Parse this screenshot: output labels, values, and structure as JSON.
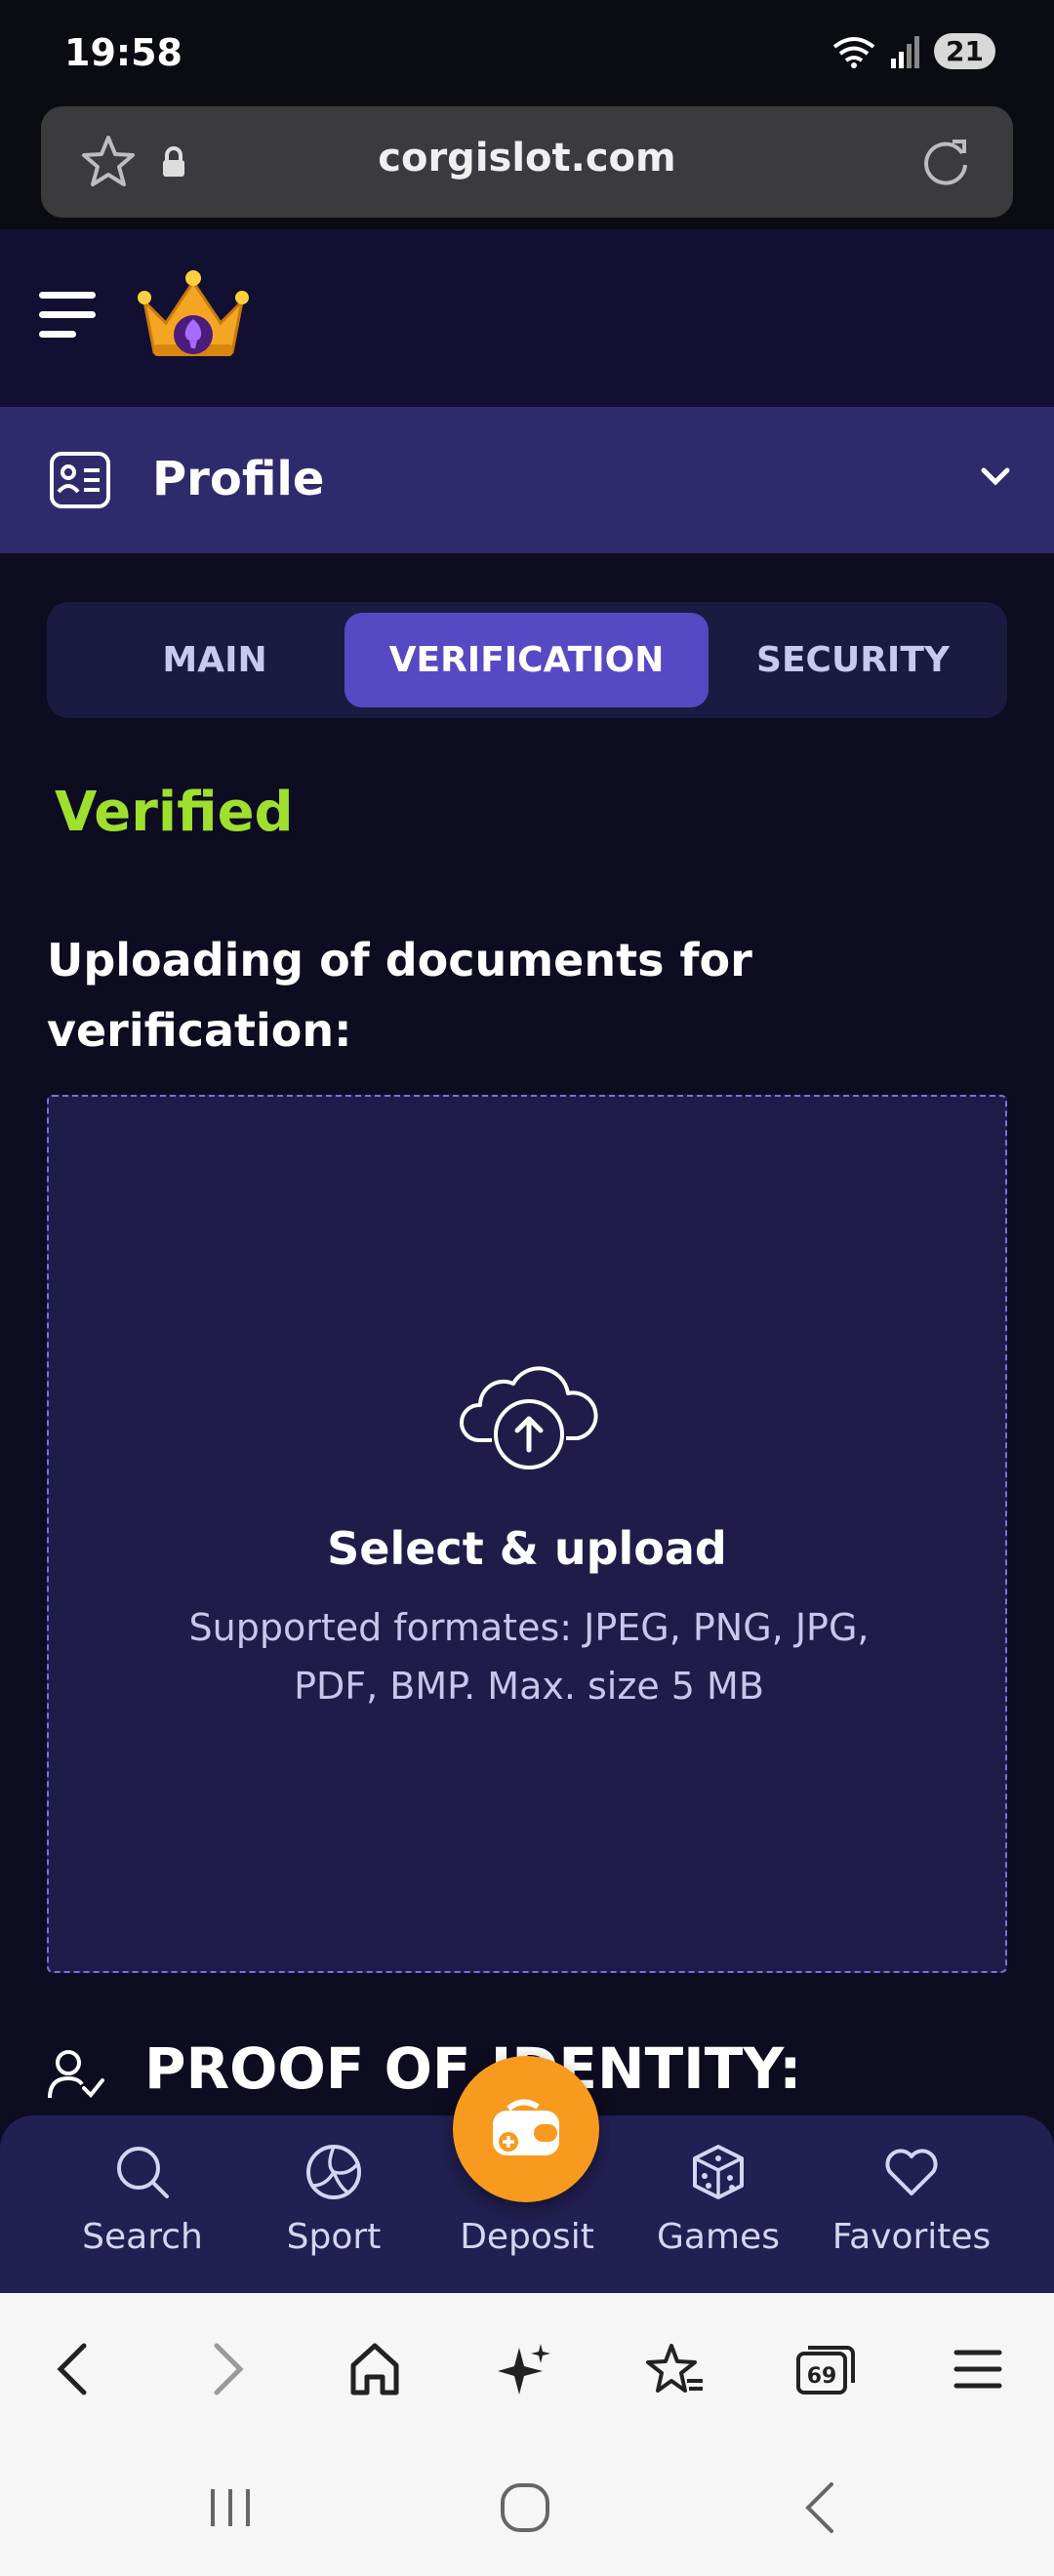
{
  "status_bar": {
    "time": "19:58",
    "battery": "21"
  },
  "browser": {
    "url": "corgislot.com"
  },
  "profile_section": {
    "title": "Profile"
  },
  "tabs": [
    {
      "label": "MAIN",
      "active": false
    },
    {
      "label": "VERIFICATION",
      "active": true
    },
    {
      "label": "SECURITY",
      "active": false
    }
  ],
  "verification": {
    "status": "Verified",
    "upload_heading": "Uploading of documents for verification:",
    "upload_title": "Select & upload",
    "upload_formats": "Supported formates: JPEG, PNG, JPG, PDF, BMP. Max. size 5 MB",
    "proof_heading": "PROOF OF IDENTITY:"
  },
  "bottom_nav": {
    "search": "Search",
    "sport": "Sport",
    "deposit": "Deposit",
    "games": "Games",
    "favorites": "Favorites"
  },
  "browser_toolbar": {
    "tabs_count": "69"
  },
  "colors": {
    "accent": "#5649c4",
    "verified": "#9ee02d",
    "deposit": "#f79a1e",
    "profile_bar": "#2e2b6c",
    "background": "#0d0c20"
  }
}
